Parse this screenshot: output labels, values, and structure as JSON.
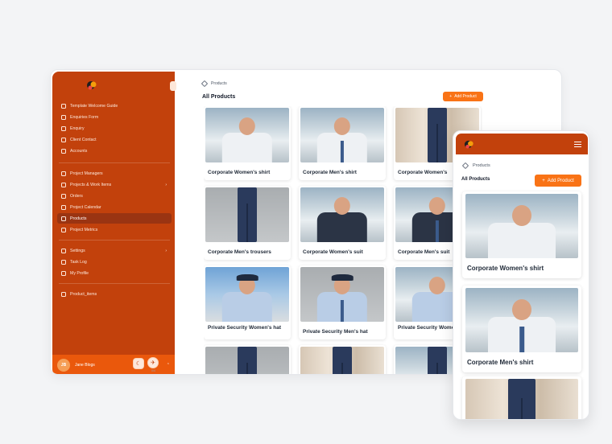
{
  "sidebar": {
    "nav_group_1": [
      {
        "label": "Template Welcome Guide",
        "icon": "document-icon"
      },
      {
        "label": "Enquiries Form",
        "icon": "link-icon"
      },
      {
        "label": "Enquiry",
        "icon": "inbox-icon"
      },
      {
        "label": "Client Contact",
        "icon": "user-icon"
      },
      {
        "label": "Accounts",
        "icon": "card-icon"
      }
    ],
    "nav_group_2": [
      {
        "label": "Project Managers",
        "icon": "clipboard-icon"
      },
      {
        "label": "Projects & Work Items",
        "icon": "folder-icon",
        "chevron": "›"
      },
      {
        "label": "Orders",
        "icon": "pin-icon"
      },
      {
        "label": "Project Calendar",
        "icon": "calendar-icon"
      },
      {
        "label": "Products",
        "icon": "cube-icon",
        "active": true
      },
      {
        "label": "Project Metrics",
        "icon": "chart-icon"
      }
    ],
    "nav_group_3": [
      {
        "label": "Settings",
        "icon": "gear-icon",
        "chevron": "›"
      },
      {
        "label": "Task Log",
        "icon": "list-icon"
      },
      {
        "label": "My Profile",
        "icon": "profile-icon"
      }
    ],
    "nav_group_4": [
      {
        "label": "Product_items",
        "icon": "document-icon"
      }
    ],
    "user": {
      "initials": "JB",
      "name": "Jane Blogs",
      "chevron": "⌃"
    }
  },
  "floating": {
    "theme_icon": "☾",
    "launch_icon": "✈",
    "launch_caption": "0/4"
  },
  "main": {
    "breadcrumb": "Products",
    "title": "All Products",
    "add_label": "Add Product",
    "add_icon": "+"
  },
  "products": [
    {
      "title": "Corporate Women's shirt",
      "photo": "office-woman-white"
    },
    {
      "title": "Corporate Men's shirt",
      "photo": "office-man-white"
    },
    {
      "title": "Corporate Women's",
      "photo": "curtain-legs"
    },
    {
      "title": "Corporate Men's trousers",
      "photo": "grey-legs"
    },
    {
      "title": "Corporate Women's suit",
      "photo": "office-woman-suit"
    },
    {
      "title": "Corporate Men's suit",
      "photo": "office-man-suit"
    },
    {
      "title": "Private Security Women's hat",
      "photo": "sky-woman-hat"
    },
    {
      "title": "Private Security Men's hat",
      "photo": "grey-man-hat"
    },
    {
      "title": "Private Security Women's shirt",
      "photo": "office-woman-blue"
    },
    {
      "title": "",
      "photo": "grey-legs"
    },
    {
      "title": "",
      "photo": "curtain-legs"
    },
    {
      "title": "",
      "photo": "office-legs"
    }
  ],
  "mobile": {
    "breadcrumb": "Products",
    "title": "All Products",
    "add_label": "Add Product",
    "add_icon": "+",
    "cards": [
      {
        "title": "Corporate Women's shirt",
        "photo": "office-woman-white"
      },
      {
        "title": "Corporate Men's shirt",
        "photo": "office-man-white"
      },
      {
        "title": "",
        "photo": "curtain-legs"
      }
    ]
  },
  "colors": {
    "brand": "#c2410c",
    "accent": "#f97316",
    "active": "#9a3412"
  }
}
